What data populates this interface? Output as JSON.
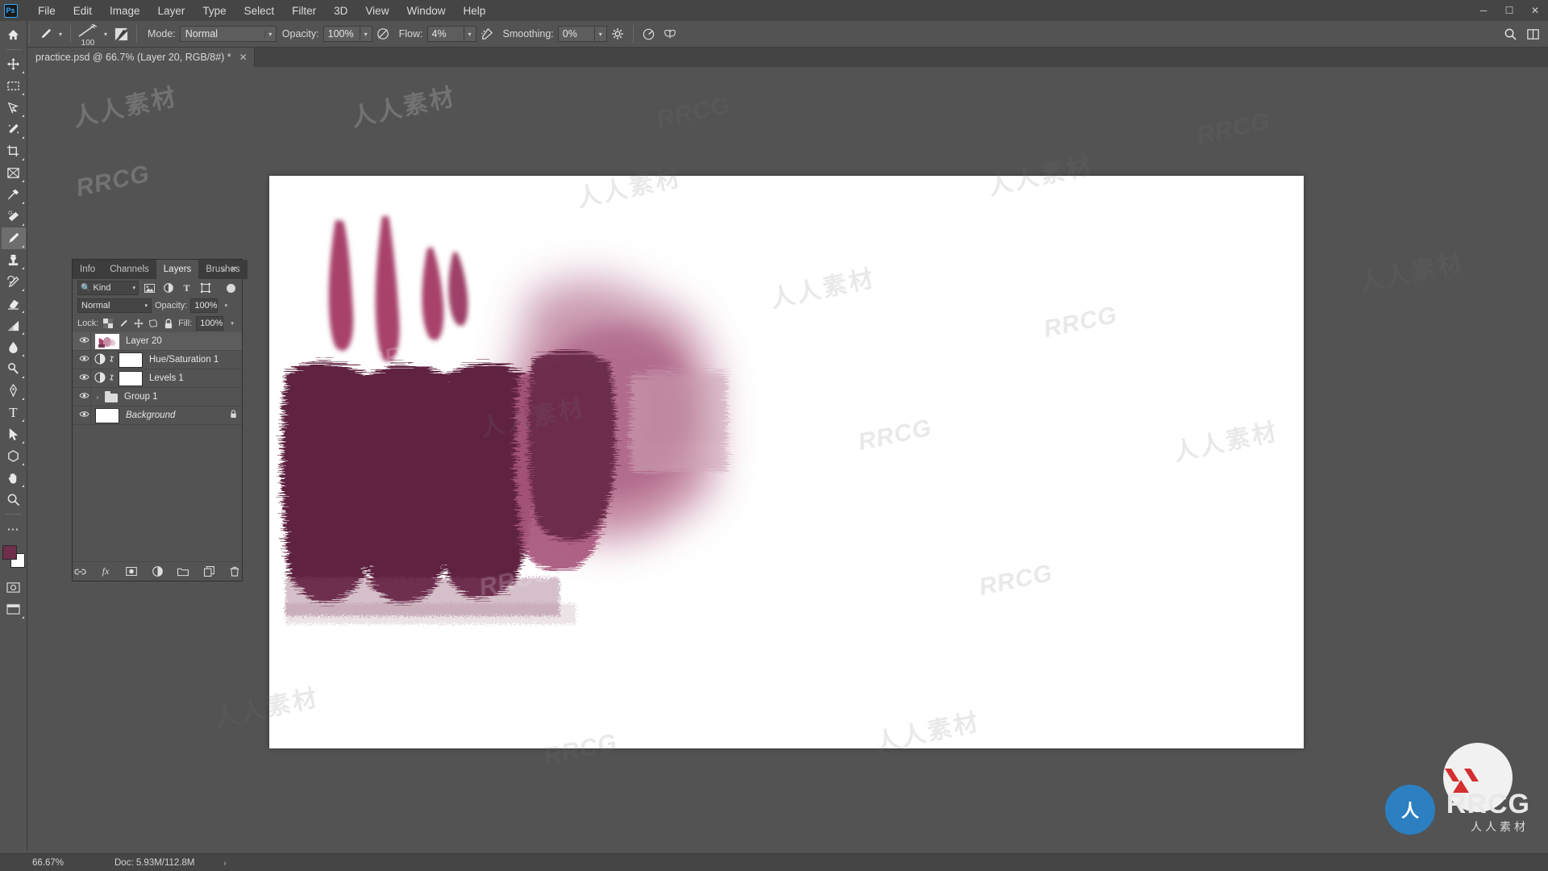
{
  "app": {
    "name": "Adobe Photoshop",
    "logo_text": "Ps",
    "accent": "#31a8ff",
    "chrome_bg": "#535353",
    "panel_bg": "#454545"
  },
  "menubar": {
    "items": [
      "File",
      "Edit",
      "Image",
      "Layer",
      "Type",
      "Select",
      "Filter",
      "3D",
      "View",
      "Window",
      "Help"
    ],
    "window_controls": [
      {
        "name": "minimize-button",
        "glyph": "─"
      },
      {
        "name": "maximize-button",
        "glyph": "☐"
      },
      {
        "name": "close-button",
        "glyph": "✕"
      }
    ]
  },
  "options_bar": {
    "tool_icon": "brush-tool-preset-icon",
    "brush_size": "100",
    "mode_label": "Mode:",
    "mode_value": "Normal",
    "opacity_label": "Opacity:",
    "opacity_value": "100%",
    "flow_label": "Flow:",
    "flow_value": "4%",
    "smoothing_label": "Smoothing:",
    "smoothing_value": "0%",
    "pressure_opacity_icon": "pressure-opacity-icon",
    "airbrush_icon": "airbrush-icon",
    "smoothing_options_icon": "gear-icon",
    "symmetry_icon": "butterfly-symmetry-icon",
    "angle_icon": "brush-angle-icon",
    "tablet_pressure_icon": "tablet-pressure-size-icon",
    "search_icon": "search-icon",
    "arrange_icon": "arrange-documents-icon"
  },
  "document_tab": {
    "title": "practice.psd @ 66.7% (Layer 20, RGB/8#) *",
    "close_glyph": "✕"
  },
  "toolbar": {
    "tools": [
      {
        "name": "home-button",
        "glyph": "⌂",
        "active": false,
        "has_flyout": false
      },
      {
        "name": "move-tool",
        "glyph": "✥",
        "active": false,
        "has_flyout": true
      },
      {
        "name": "rectangular-marquee-tool",
        "glyph": "⬚",
        "active": false,
        "has_flyout": true
      },
      {
        "name": "lasso-tool",
        "glyph": "☂",
        "active": false,
        "has_flyout": true
      },
      {
        "name": "magic-wand-tool",
        "glyph": "✦",
        "active": false,
        "has_flyout": true
      },
      {
        "name": "crop-tool",
        "glyph": "⛶",
        "active": false,
        "has_flyout": true
      },
      {
        "name": "frame-tool",
        "glyph": "⌧",
        "active": false,
        "has_flyout": true
      },
      {
        "name": "eyedropper-tool",
        "glyph": "✒",
        "active": false,
        "has_flyout": true
      },
      {
        "name": "spot-healing-brush-tool",
        "glyph": "☙",
        "active": false,
        "has_flyout": true
      },
      {
        "name": "brush-tool",
        "glyph": "✎",
        "active": true,
        "has_flyout": true
      },
      {
        "name": "clone-stamp-tool",
        "glyph": "⚑",
        "active": false,
        "has_flyout": true
      },
      {
        "name": "history-brush-tool",
        "glyph": "✐",
        "active": false,
        "has_flyout": true
      },
      {
        "name": "eraser-tool",
        "glyph": "▱",
        "active": false,
        "has_flyout": true
      },
      {
        "name": "gradient-tool",
        "glyph": "◢",
        "active": false,
        "has_flyout": true
      },
      {
        "name": "blur-tool",
        "glyph": "●",
        "active": false,
        "has_flyout": true
      },
      {
        "name": "dodge-tool",
        "glyph": "⚲",
        "active": false,
        "has_flyout": true
      },
      {
        "name": "pen-tool",
        "glyph": "✑",
        "active": false,
        "has_flyout": true
      },
      {
        "name": "horizontal-type-tool",
        "glyph": "T",
        "active": false,
        "has_flyout": true
      },
      {
        "name": "path-selection-tool",
        "glyph": "➤",
        "active": false,
        "has_flyout": true
      },
      {
        "name": "rectangle-shape-tool",
        "glyph": "⬡",
        "active": false,
        "has_flyout": true
      },
      {
        "name": "hand-tool",
        "glyph": "✋",
        "active": false,
        "has_flyout": true
      },
      {
        "name": "zoom-tool",
        "glyph": "⚲",
        "active": false,
        "has_flyout": false
      },
      {
        "name": "edit-toolbar-button",
        "glyph": "⋯",
        "active": false,
        "has_flyout": false
      }
    ],
    "foreground_color": "#6d2f4a",
    "background_color": "#ffffff",
    "quick_mask_icon": "quick-mask-mode-icon",
    "screen_mode_icon": "screen-mode-icon"
  },
  "panel": {
    "tabs": [
      {
        "label": "Info",
        "active": false
      },
      {
        "label": "Channels",
        "active": false
      },
      {
        "label": "Layers",
        "active": true
      },
      {
        "label": "Brushes",
        "active": false
      }
    ],
    "collapse_glyph": "«",
    "close_glyph": "✕",
    "filter": {
      "search_icon": "search-icon",
      "kind_value": "Kind",
      "buttons": [
        {
          "name": "filter-pixel-layers-icon",
          "glyph": "▣"
        },
        {
          "name": "filter-adjustment-layers-icon",
          "glyph": "◑"
        },
        {
          "name": "filter-type-layers-icon",
          "glyph": "T"
        },
        {
          "name": "filter-shape-layers-icon",
          "glyph": "⬚"
        },
        {
          "name": "filter-smart-object-layers-icon",
          "glyph": "◰"
        }
      ],
      "toggle_name": "filter-enable-toggle"
    },
    "blend": {
      "mode_value": "Normal",
      "opacity_label": "Opacity:",
      "opacity_value": "100%"
    },
    "lock": {
      "label": "Lock:",
      "items": [
        {
          "name": "lock-transparent-pixels-icon",
          "glyph": "▒"
        },
        {
          "name": "lock-image-pixels-icon",
          "glyph": "✎"
        },
        {
          "name": "lock-position-icon",
          "glyph": "✥"
        },
        {
          "name": "lock-artboard-nesting-icon",
          "glyph": "⬚"
        },
        {
          "name": "lock-all-icon",
          "glyph": "⚿"
        }
      ],
      "fill_label": "Fill:",
      "fill_value": "100%"
    },
    "layers": [
      {
        "name": "Layer 20",
        "type": "pixel",
        "visible": true,
        "selected": true,
        "italic": false,
        "locked": false,
        "has_mask": false,
        "eye_glyph": "◉"
      },
      {
        "name": "Hue/Saturation 1",
        "type": "adjustment",
        "visible": true,
        "selected": false,
        "italic": false,
        "locked": false,
        "has_mask": true,
        "eye_glyph": "◉",
        "adjustment_icon": "hue-saturation-adjustment-icon",
        "link_icon": "link-mask-icon"
      },
      {
        "name": "Levels 1",
        "type": "adjustment",
        "visible": true,
        "selected": false,
        "italic": false,
        "locked": false,
        "has_mask": true,
        "eye_glyph": "◉",
        "adjustment_icon": "levels-adjustment-icon",
        "link_icon": "link-mask-icon"
      },
      {
        "name": "Group 1",
        "type": "group",
        "visible": true,
        "selected": false,
        "italic": false,
        "locked": false,
        "has_mask": false,
        "eye_glyph": "◉",
        "expand_glyph": "›",
        "folder_icon": "folder-icon"
      },
      {
        "name": "Background",
        "type": "background",
        "visible": true,
        "selected": false,
        "italic": true,
        "locked": true,
        "has_mask": false,
        "eye_glyph": "◉",
        "lock_glyph": "⚿"
      }
    ],
    "footer_buttons": [
      {
        "name": "link-layers-button",
        "glyph": "⚭"
      },
      {
        "name": "add-layer-style-button",
        "glyph": "fx"
      },
      {
        "name": "add-layer-mask-button",
        "glyph": "▣"
      },
      {
        "name": "new-adjustment-layer-button",
        "glyph": "◑"
      },
      {
        "name": "new-group-button",
        "glyph": "▰"
      },
      {
        "name": "new-layer-button",
        "glyph": "⧉"
      },
      {
        "name": "delete-layer-button",
        "glyph": "Ὕ1"
      }
    ]
  },
  "status_bar": {
    "zoom": "66.67%",
    "doc_info": "Doc: 5.93M/112.8M",
    "expand_glyph": "›"
  },
  "flow_slider_popup": {
    "name": "flow-slider-popup",
    "value_percent": 4
  },
  "watermarks": {
    "cn": "人人素材",
    "en": "RRCG"
  },
  "brand": {
    "circle_text": "人",
    "name": "RRCG",
    "subtitle": "人人素材"
  },
  "canvas_artwork": {
    "description": "magenta / maroon paint brush strokes on white canvas",
    "colors": {
      "crimson": "#a8436b",
      "deep_maroon": "#5e2140",
      "soft_pink": "#c08aa4",
      "pale_pink": "#d9b4c4"
    }
  }
}
